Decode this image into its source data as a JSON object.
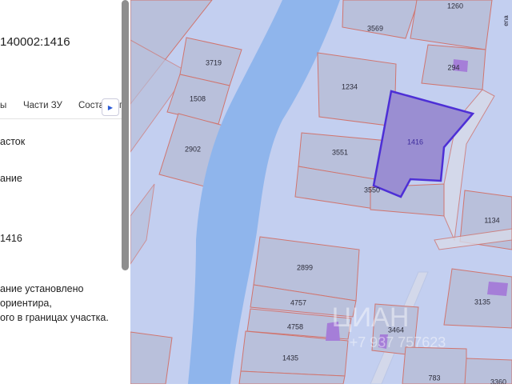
{
  "panel": {
    "cadastral_number": "140002:1416",
    "tabs": [
      {
        "label": "ы"
      },
      {
        "label": "Части ЗУ"
      },
      {
        "label": "Соста"
      },
      {
        "label": "г"
      }
    ],
    "rows": [
      {
        "text": "асток"
      },
      {
        "text": "ание"
      },
      {
        "text": "1416"
      }
    ],
    "note_lines": [
      "ание установлено",
      "ориентира,",
      "ого в границах участка."
    ]
  },
  "map": {
    "colors": {
      "background": "#c3cff0",
      "river": "#8fb5ec",
      "parcel_fill": "#b9c0db",
      "parcel_border": "#d0756f",
      "selected_fill": "#9a8ed2",
      "selected_border": "#4d2fd6",
      "building": "#a57ed8"
    },
    "edge_label": "ena",
    "parcels": [
      {
        "label": "1260"
      },
      {
        "label": "3569"
      },
      {
        "label": "3719"
      },
      {
        "label": "294"
      },
      {
        "label": "1234"
      },
      {
        "label": "1508"
      },
      {
        "label": "1416"
      },
      {
        "label": "2902"
      },
      {
        "label": "3551"
      },
      {
        "label": "3550"
      },
      {
        "label": "1134"
      },
      {
        "label": "2899"
      },
      {
        "label": "3135"
      },
      {
        "label": "4757"
      },
      {
        "label": "4758"
      },
      {
        "label": "3464"
      },
      {
        "label": "1435"
      },
      {
        "label": "783"
      },
      {
        "label": "3360"
      }
    ],
    "watermark": {
      "brand": "ЦИАН",
      "phone": "+7 937 757623"
    }
  }
}
